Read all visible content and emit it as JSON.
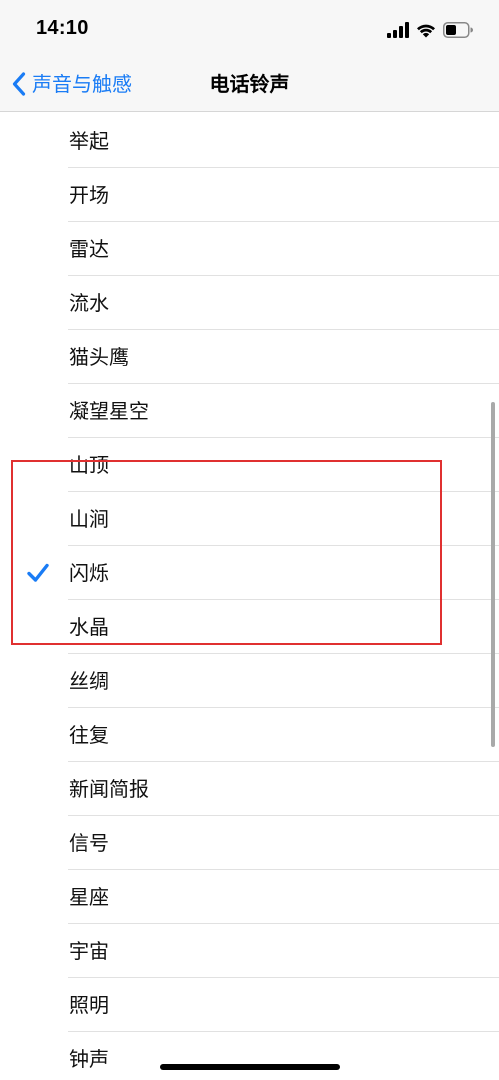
{
  "status_bar": {
    "time": "14:10",
    "icons": [
      "cellular-signal-icon",
      "wifi-icon",
      "battery-icon"
    ]
  },
  "nav": {
    "back_label": "声音与触感",
    "title": "电话铃声"
  },
  "accent_color": "#1a7cf5",
  "ringtones": [
    {
      "label": "举起",
      "selected": false
    },
    {
      "label": "开场",
      "selected": false
    },
    {
      "label": "雷达",
      "selected": false
    },
    {
      "label": "流水",
      "selected": false
    },
    {
      "label": "猫头鹰",
      "selected": false
    },
    {
      "label": "凝望星空",
      "selected": false
    },
    {
      "label": "山顶",
      "selected": false
    },
    {
      "label": "山涧",
      "selected": false
    },
    {
      "label": "闪烁",
      "selected": true
    },
    {
      "label": "水晶",
      "selected": false
    },
    {
      "label": "丝绸",
      "selected": false
    },
    {
      "label": "往复",
      "selected": false
    },
    {
      "label": "新闻简报",
      "selected": false
    },
    {
      "label": "信号",
      "selected": false
    },
    {
      "label": "星座",
      "selected": false
    },
    {
      "label": "宇宙",
      "selected": false
    },
    {
      "label": "照明",
      "selected": false
    },
    {
      "label": "钟声",
      "selected": false
    }
  ]
}
